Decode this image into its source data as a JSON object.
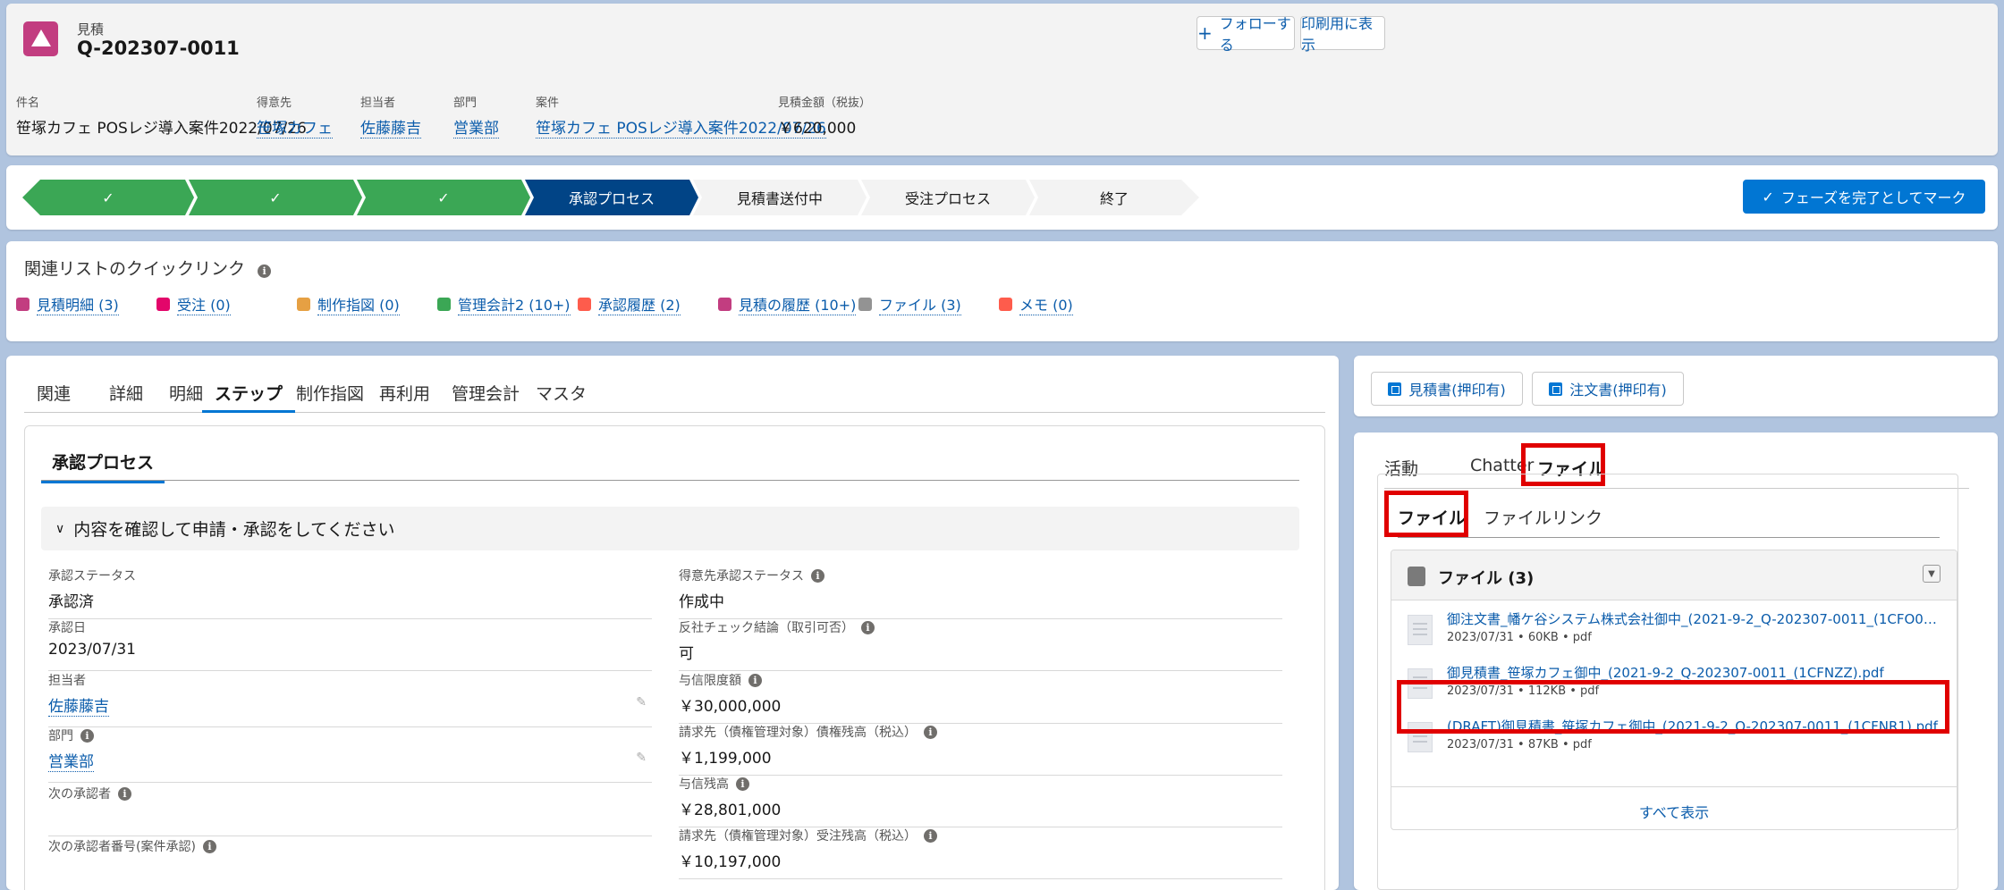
{
  "header": {
    "object_type": "見積",
    "record_name": "Q-202307-0011",
    "follow_label": "フォローする",
    "print_label": "印刷用に表示",
    "fields": [
      {
        "label": "件名",
        "value": "笹塚カフェ POSレジ導入案件2022/07/26",
        "link": false
      },
      {
        "label": "得意先",
        "value": "笹塚カフェ",
        "link": true
      },
      {
        "label": "担当者",
        "value": "佐藤藤吉",
        "link": true
      },
      {
        "label": "部門",
        "value": "営業部",
        "link": true
      },
      {
        "label": "案件",
        "value": "笹塚カフェ POSレジ導入案件2022/07/26",
        "link": true
      },
      {
        "label": "見積金額（税抜）",
        "value": "￥620,000",
        "link": false
      }
    ]
  },
  "path": {
    "stages": [
      {
        "label": "✓",
        "state": "done"
      },
      {
        "label": "✓",
        "state": "done"
      },
      {
        "label": "✓",
        "state": "done"
      },
      {
        "label": "承認プロセス",
        "state": "current"
      },
      {
        "label": "見積書送付中",
        "state": "next"
      },
      {
        "label": "受注プロセス",
        "state": "next"
      },
      {
        "label": "終了",
        "state": "next"
      }
    ],
    "mark_complete_label": "フェーズを完了としてマーク"
  },
  "quick_links": {
    "title": "関連リストのクイックリンク",
    "items": [
      {
        "label": "見積明細 (3)",
        "color": "#c23d80"
      },
      {
        "label": "受注 (0)",
        "color": "#e3066a"
      },
      {
        "label": "制作指図 (0)",
        "color": "#e6a043"
      },
      {
        "label": "管理会計2 (10+)",
        "color": "#3ba755"
      },
      {
        "label": "承認履歴 (2)",
        "color": "#fe5c4c"
      },
      {
        "label": "見積の履歴 (10+)",
        "color": "#c23d80"
      },
      {
        "label": "ファイル (3)",
        "color": "#939393"
      },
      {
        "label": "メモ (0)",
        "color": "#fe5c4c"
      }
    ]
  },
  "main_tabs": [
    "関連",
    "詳細",
    "明細",
    "ステップ",
    "制作指図",
    "再利用",
    "管理会計",
    "マスタ"
  ],
  "active_main_tab": "ステップ",
  "step": {
    "subtab": "承認プロセス",
    "section_title": "内容を確認して申請・承認をしてください",
    "left_fields": [
      {
        "label": "承認ステータス",
        "value": "承認済",
        "info": false,
        "link": false,
        "edit": false
      },
      {
        "label": "承認日",
        "value": "2023/07/31",
        "info": false,
        "link": false,
        "edit": false
      },
      {
        "label": "担当者",
        "value": "佐藤藤吉",
        "info": false,
        "link": true,
        "edit": true
      },
      {
        "label": "部門",
        "value": "営業部",
        "info": true,
        "link": true,
        "edit": true
      },
      {
        "label": "次の承認者",
        "value": "",
        "info": true,
        "link": false,
        "edit": false
      },
      {
        "label": "次の承認者番号(案件承認)",
        "value": "",
        "info": true,
        "link": false,
        "edit": false
      }
    ],
    "right_fields": [
      {
        "label": "得意先承認ステータス",
        "value": "作成中",
        "info": true
      },
      {
        "label": "反社チェック結論（取引可否）",
        "value": "可",
        "info": true
      },
      {
        "label": "与信限度額",
        "value": "￥30,000,000",
        "info": true
      },
      {
        "label": "請求先（債権管理対象）債権残高（税込）",
        "value": "￥1,199,000",
        "info": true
      },
      {
        "label": "与信残高",
        "value": "￥28,801,000",
        "info": true
      },
      {
        "label": "請求先（債権管理対象）受注残高（税込）",
        "value": "￥10,197,000",
        "info": true
      }
    ]
  },
  "right_buttons": [
    "見積書(押印有)",
    "注文書(押印有)"
  ],
  "right_tabs": [
    "活動",
    "Chatter",
    "ファイル"
  ],
  "file_subtabs": [
    "ファイル",
    "ファイルリンク"
  ],
  "files_card": {
    "title": "ファイル (3)",
    "files": [
      {
        "name": "御注文書_幡ケ谷システム株式会社御中_(2021-9-2_Q-202307-0011_(1CFO03)...",
        "meta": "2023/07/31 • 60KB • pdf"
      },
      {
        "name": "御見積書_笹塚カフェ御中_(2021-9-2_Q-202307-0011_(1CFNZZ).pdf",
        "meta": "2023/07/31 • 112KB • pdf"
      },
      {
        "name": "(DRAFT)御見積書_笹塚カフェ御中_(2021-9-2_Q-202307-0011_(1CFNR1).pdf",
        "meta": "2023/07/31 • 87KB • pdf"
      }
    ],
    "view_all": "すべて表示"
  }
}
